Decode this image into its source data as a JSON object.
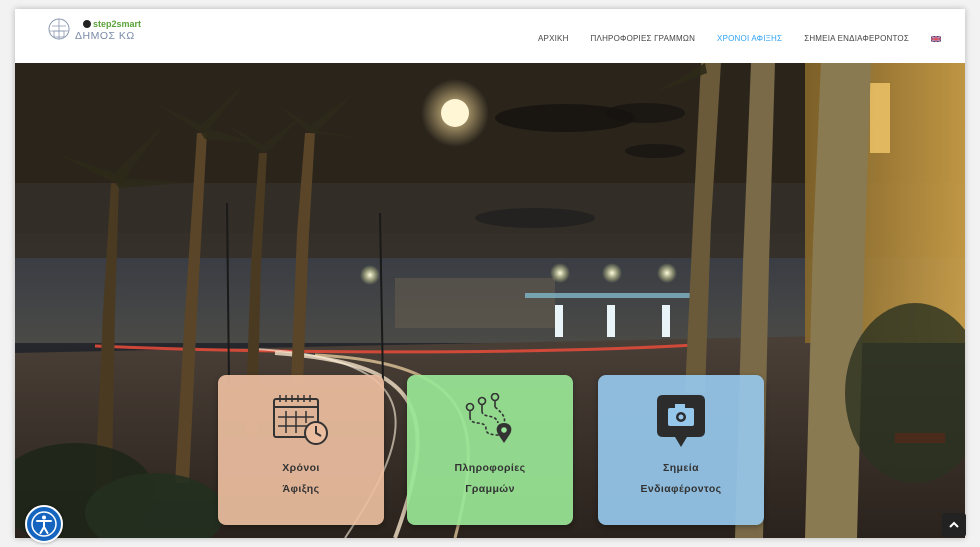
{
  "header": {
    "logo_brand": "step2smart",
    "logo_municipality": "ΔΗΜΟΣ ΚΩ",
    "nav": [
      {
        "label": "ΑΡΧΙΚΗ",
        "active": false
      },
      {
        "label": "ΠΛΗΡΟΦΟΡΙΕΣ ΓΡΑΜΜΩΝ",
        "active": false
      },
      {
        "label": "ΧΡΟΝΟΙ ΑΦΙΞΗΣ",
        "active": true
      },
      {
        "label": "ΣΗΜΕΙΑ ΕΝΔΙΑΦΕΡΟΝΤΟΣ",
        "active": false
      }
    ],
    "language_flag": "uk-flag-icon",
    "active_color": "#2ea3f2"
  },
  "cards": [
    {
      "line1": "Χρόνοι",
      "line2": "Άφιξης",
      "icon": "calendar-clock-icon",
      "color": "#ecbea0"
    },
    {
      "line1": "Πληροφορίες",
      "line2": "Γραμμών",
      "icon": "route-map-icon",
      "color": "#99e696"
    },
    {
      "line1": "Σημεία",
      "line2": "Ενδιαφέροντος",
      "icon": "camera-pin-icon",
      "color": "#96c8eb"
    }
  ],
  "floating": {
    "accessibility_icon": "accessibility-icon",
    "back_to_top_icon": "chevron-up-icon"
  }
}
